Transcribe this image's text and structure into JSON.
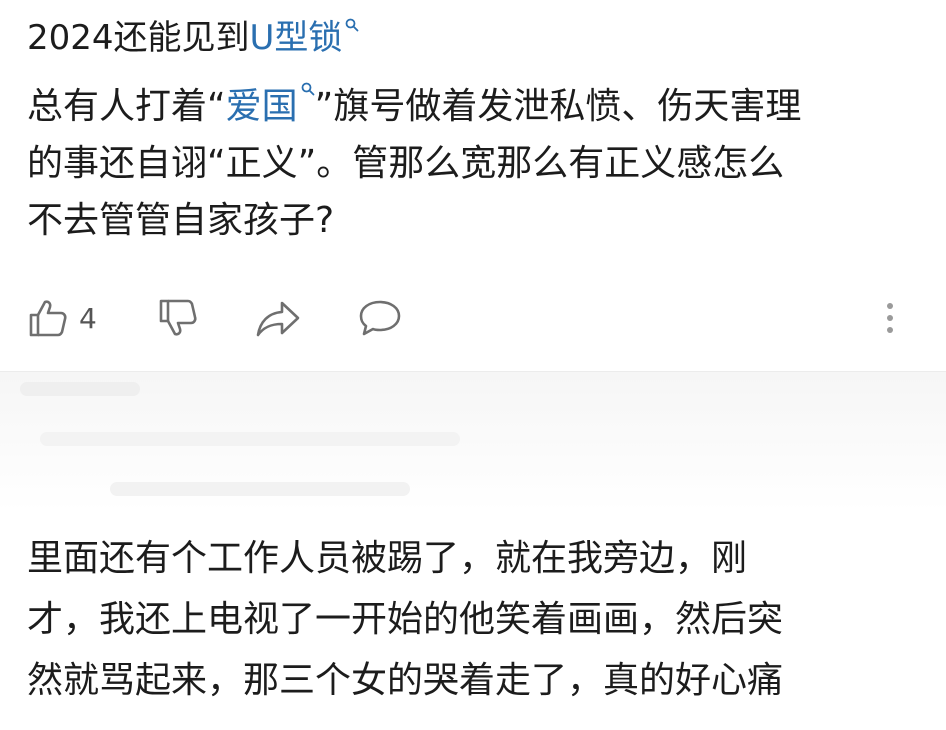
{
  "comment1": {
    "title_prefix": "2024还能见到",
    "title_link": "U型锁",
    "body": {
      "line1_pre": "总有人打着“",
      "line1_link": "爱国",
      "line1_post": "”旗号做着发泄私愤、伤天害理",
      "line2": "的事还自诩“正义”。管那么宽那么有正义感怎么",
      "line3": "不去管管自家孩子?"
    },
    "actions": {
      "like_count": "4"
    }
  },
  "comment2": {
    "lines": [
      "里面还有个工作人员被踢了，就在我旁边，刚",
      "才，我还上电视了一开始的他笑着画画，然后突",
      "然就骂起来，那三个女的哭着走了，真的好心痛"
    ]
  },
  "colors": {
    "link": "#2a6fb0",
    "icon": "#6f6f6f",
    "text": "#1c1c1c"
  },
  "icons": {
    "like": "thumbs-up-icon",
    "dislike": "thumbs-down-icon",
    "share": "share-icon",
    "reply": "comment-icon",
    "more": "more-vertical-icon",
    "search": "search-icon"
  }
}
